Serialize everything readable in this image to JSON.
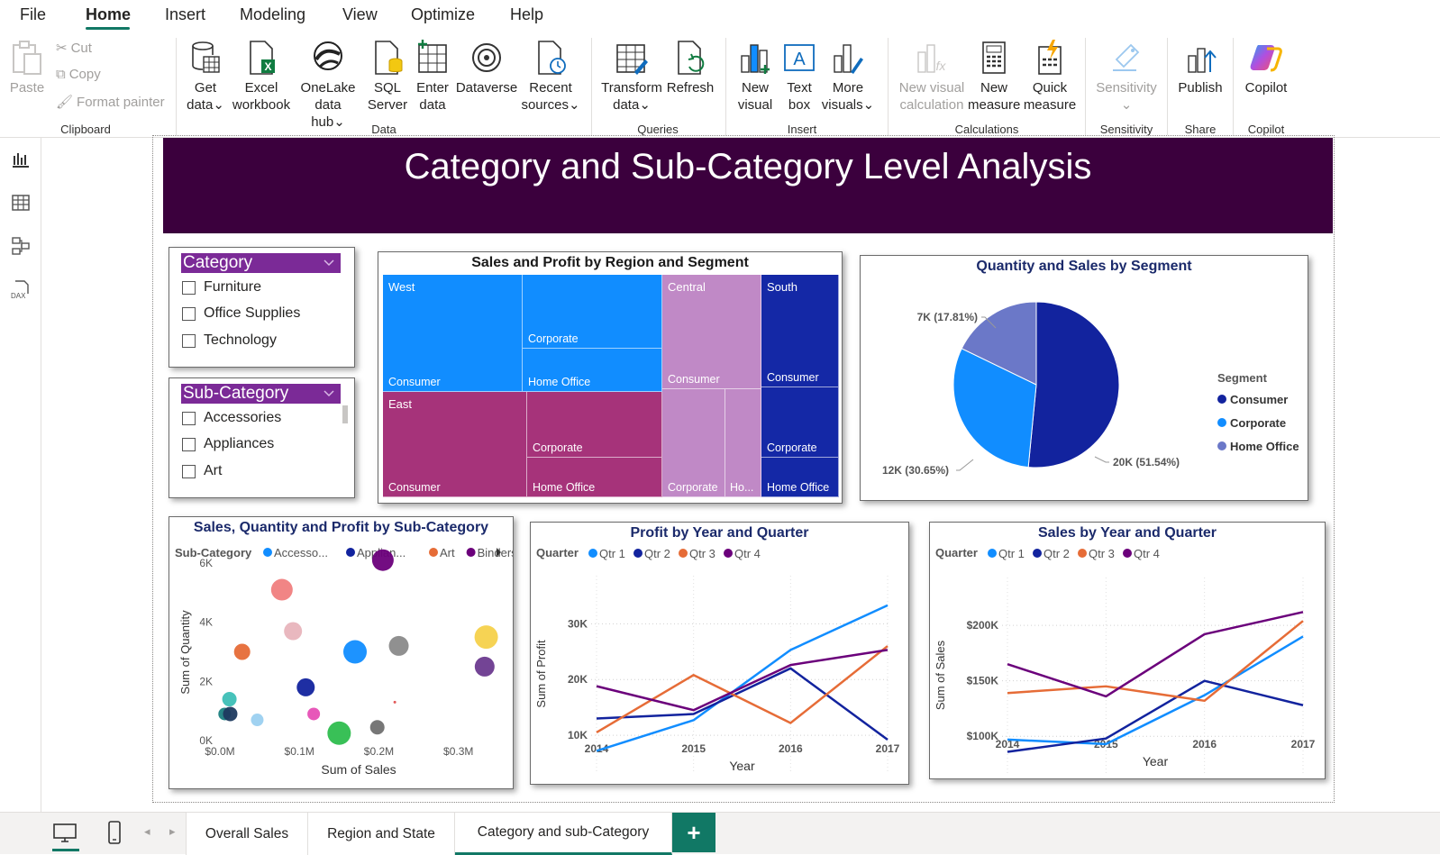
{
  "menu": [
    "File",
    "Home",
    "Insert",
    "Modeling",
    "View",
    "Optimize",
    "Help"
  ],
  "active_menu": "Home",
  "ribbon": {
    "clipboard": {
      "paste": "Paste",
      "cut": "Cut",
      "copy": "Copy",
      "format_painter": "Format painter",
      "label": "Clipboard"
    },
    "data": {
      "get_data": [
        "Get",
        "data"
      ],
      "excel": [
        "Excel",
        "workbook"
      ],
      "onelake": [
        "OneLake",
        "data hub"
      ],
      "sql": [
        "SQL",
        "Server"
      ],
      "enter": [
        "Enter",
        "data"
      ],
      "dataverse": "Dataverse",
      "recent": [
        "Recent",
        "sources"
      ],
      "label": "Data"
    },
    "queries": {
      "transform": [
        "Transform",
        "data"
      ],
      "refresh": "Refresh",
      "label": "Queries"
    },
    "insert": {
      "new_visual": [
        "New",
        "visual"
      ],
      "text_box": [
        "Text",
        "box"
      ],
      "more_visuals": [
        "More",
        "visuals"
      ],
      "label": "Insert"
    },
    "calculations": {
      "new_visual_calc": [
        "New visual",
        "calculation"
      ],
      "new_measure": [
        "New",
        "measure"
      ],
      "quick_measure": [
        "Quick",
        "measure"
      ],
      "label": "Calculations"
    },
    "sensitivity": {
      "btn": "Sensitivity",
      "label": "Sensitivity"
    },
    "share": {
      "publish": "Publish",
      "label": "Share"
    },
    "copilot": {
      "btn": "Copilot",
      "label": "Copilot"
    }
  },
  "banner_title": "Category and Sub-Category Level Analysis",
  "slicer_category": {
    "title": "Category",
    "items": [
      "Furniture",
      "Office Supplies",
      "Technology"
    ]
  },
  "slicer_subcategory": {
    "title": "Sub-Category",
    "items": [
      "Accessories",
      "Appliances",
      "Art"
    ]
  },
  "treemap": {
    "title": "Sales and Profit by Region and Segment",
    "regions": [
      {
        "name": "West",
        "color": "#118dff",
        "segments": [
          "Consumer",
          "Corporate",
          "Home Office"
        ]
      },
      {
        "name": "East",
        "color": "#a6337a",
        "segments": [
          "Consumer",
          "Corporate",
          "Home Office"
        ]
      },
      {
        "name": "Central",
        "color": "#c089c6",
        "segments": [
          "Consumer",
          "Corporate",
          "Ho..."
        ]
      },
      {
        "name": "South",
        "color": "#1428a6",
        "segments": [
          "Consumer",
          "Corporate",
          "Home Office"
        ]
      }
    ]
  },
  "pie": {
    "title": "Quantity and Sales by Segment",
    "legend_title": "Segment",
    "slices": [
      {
        "name": "Consumer",
        "label": "20K (51.54%)",
        "value": 51.54,
        "color": "#12239e"
      },
      {
        "name": "Corporate",
        "label": "12K (30.65%)",
        "value": 30.65,
        "color": "#118dff"
      },
      {
        "name": "Home Office",
        "label": "7K (17.81%)",
        "value": 17.81,
        "color": "#6b78c8"
      }
    ]
  },
  "scatter": {
    "title": "Sales, Quantity and Profit by Sub-Category",
    "legend_title": "Sub-Category",
    "legend": [
      {
        "name": "Accesso...",
        "color": "#118dff"
      },
      {
        "name": "Applian...",
        "color": "#12239e"
      },
      {
        "name": "Art",
        "color": "#e66c37"
      },
      {
        "name": "Binders",
        "color": "#6b007b"
      }
    ],
    "xlabel": "Sum of Sales",
    "ylabel": "Sum of Quantity",
    "xticks": [
      "$0.0M",
      "$0.1M",
      "$0.2M",
      "$0.3M"
    ],
    "yticks": [
      "0K",
      "2K",
      "4K",
      "6K"
    ],
    "xlim": [
      0,
      0.34
    ],
    "ylim": [
      0,
      6000
    ],
    "points": [
      {
        "x": 0.078,
        "y": 5100,
        "r": 12,
        "color": "#f07e7e"
      },
      {
        "x": 0.205,
        "y": 6100,
        "r": 12,
        "color": "#6b007b"
      },
      {
        "x": 0.092,
        "y": 3700,
        "r": 10,
        "color": "#e8b4bc"
      },
      {
        "x": 0.028,
        "y": 3000,
        "r": 9,
        "color": "#e66c37"
      },
      {
        "x": 0.17,
        "y": 3000,
        "r": 13,
        "color": "#118dff"
      },
      {
        "x": 0.225,
        "y": 3200,
        "r": 11,
        "color": "#8a8a8a"
      },
      {
        "x": 0.335,
        "y": 3500,
        "r": 13,
        "color": "#f5d14b"
      },
      {
        "x": 0.333,
        "y": 2500,
        "r": 11,
        "color": "#6b3a8f"
      },
      {
        "x": 0.108,
        "y": 1800,
        "r": 10,
        "color": "#12239e"
      },
      {
        "x": 0.012,
        "y": 1400,
        "r": 8,
        "color": "#3dbfb6"
      },
      {
        "x": 0.006,
        "y": 900,
        "r": 7,
        "color": "#1b7f7f"
      },
      {
        "x": 0.013,
        "y": 900,
        "r": 8,
        "color": "#1e3a5f"
      },
      {
        "x": 0.047,
        "y": 700,
        "r": 7,
        "color": "#9bd0f0"
      },
      {
        "x": 0.118,
        "y": 900,
        "r": 7,
        "color": "#e64fb5"
      },
      {
        "x": 0.15,
        "y": 250,
        "r": 13,
        "color": "#2ebd4e"
      },
      {
        "x": 0.198,
        "y": 450,
        "r": 8,
        "color": "#707070"
      },
      {
        "x": 0.22,
        "y": 1300,
        "r": 1.5,
        "color": "#e05050"
      }
    ]
  },
  "profit_chart": {
    "title": "Profit by Year and Quarter",
    "legend_title": "Quarter",
    "xlabel": "Year",
    "ylabel": "Sum of Profit",
    "years": [
      "2014",
      "2015",
      "2016",
      "2017"
    ],
    "ylim": [
      5000,
      37000
    ],
    "yticks": [
      {
        "v": 10000,
        "label": "10K"
      },
      {
        "v": 20000,
        "label": "20K"
      },
      {
        "v": 30000,
        "label": "30K"
      }
    ],
    "series": [
      {
        "name": "Qtr 1",
        "color": "#118dff",
        "values": [
          7200,
          12700,
          25300,
          33300
        ]
      },
      {
        "name": "Qtr 2",
        "color": "#12239e",
        "values": [
          13000,
          13800,
          22000,
          9200
        ]
      },
      {
        "name": "Qtr 3",
        "color": "#e66c37",
        "values": [
          10500,
          20800,
          12200,
          26000
        ]
      },
      {
        "name": "Qtr 4",
        "color": "#6b007b",
        "values": [
          18800,
          14500,
          22600,
          25300
        ]
      }
    ]
  },
  "sales_chart": {
    "title": "Sales by Year and Quarter",
    "legend_title": "Quarter",
    "xlabel": "Year",
    "ylabel": "Sum of Sales",
    "years": [
      "2014",
      "2015",
      "2016",
      "2017"
    ],
    "ylim": [
      75000,
      235000
    ],
    "yticks": [
      {
        "v": 100000,
        "label": "$100K"
      },
      {
        "v": 150000,
        "label": "$150K"
      },
      {
        "v": 200000,
        "label": "$200K"
      }
    ],
    "series": [
      {
        "name": "Qtr 1",
        "color": "#118dff",
        "values": [
          97000,
          93000,
          137000,
          190000
        ]
      },
      {
        "name": "Qtr 2",
        "color": "#12239e",
        "values": [
          86000,
          98000,
          150000,
          128000
        ]
      },
      {
        "name": "Qtr 3",
        "color": "#e66c37",
        "values": [
          139000,
          145000,
          132000,
          204000
        ]
      },
      {
        "name": "Qtr 4",
        "color": "#6b007b",
        "values": [
          165000,
          136000,
          192000,
          212000
        ]
      }
    ]
  },
  "tabs": [
    "Overall Sales",
    "Region and State",
    "Category and sub-Category"
  ],
  "active_tab": "Category and sub-Category",
  "tab_add": "+"
}
